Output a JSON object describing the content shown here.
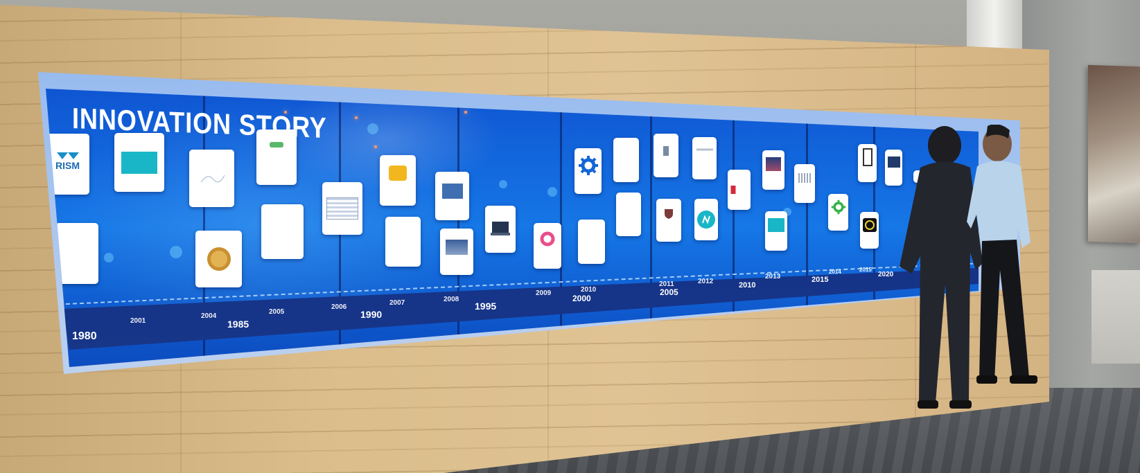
{
  "display": {
    "title": "INNOVATION STORY",
    "card_texts": {
      "prism": "RISM"
    },
    "timeline_years": {
      "y1980": "1980",
      "y1985": "1985",
      "y1990": "1990",
      "y1995": "1995",
      "y2000": "2000",
      "y2005": "2005",
      "y2010": "2010",
      "y2015": "2015",
      "y2020": "2020",
      "y2001": "2001",
      "y2004": "2004",
      "y2005b": "2005",
      "y2006": "2006",
      "y2007": "2007",
      "y2008": "2008",
      "y2009": "2009",
      "y2010b": "2010",
      "y2011": "2011",
      "y2012": "2012",
      "y2013": "2013",
      "y2014": "2014",
      "y2015b": "2015"
    }
  },
  "colors": {
    "screen_blue": "#1677e6",
    "wood": "#dbbd8b",
    "teal_icon": "#19b6c7",
    "gear_blue": "#1466d6",
    "gear_green": "#37b24d"
  },
  "icons": [
    "gear-icon",
    "network-icon",
    "medal-icon",
    "tablet-icon",
    "shield-icon",
    "copyright-icon"
  ]
}
